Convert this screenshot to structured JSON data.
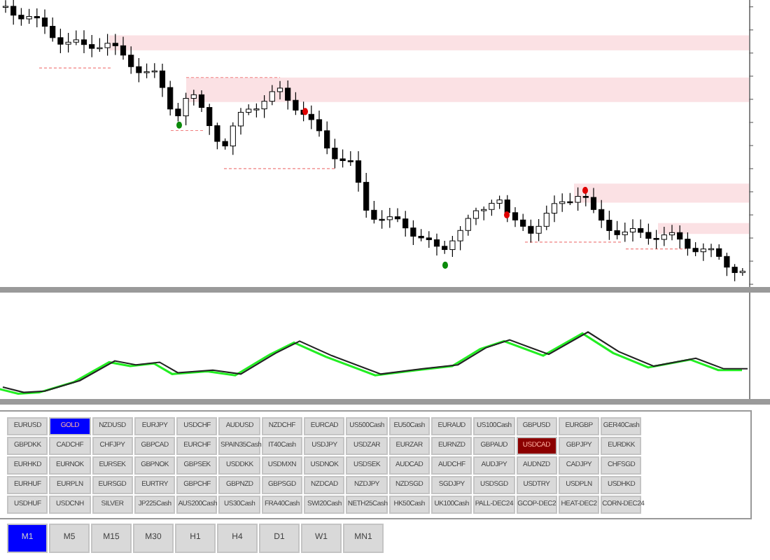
{
  "symbol_panel": {
    "rows": [
      [
        {
          "label": "EURUSD",
          "color": "#d9d9d9"
        },
        {
          "label": "GOLD",
          "color": "#0000ff"
        },
        {
          "label": "NZDUSD",
          "color": "#d9d9d9"
        },
        {
          "label": "EURJPY",
          "color": "#d9d9d9"
        },
        {
          "label": "USDCHF",
          "color": "#d9d9d9"
        },
        {
          "label": "AUDUSD",
          "color": "#d9d9d9"
        },
        {
          "label": "NZDCHF",
          "color": "#d9d9d9"
        },
        {
          "label": "EURCAD",
          "color": "#d9d9d9"
        },
        {
          "label": "US500Cash",
          "color": "#d9d9d9"
        },
        {
          "label": "EU50Cash",
          "color": "#d9d9d9"
        },
        {
          "label": "EURAUD",
          "color": "#d9d9d9"
        },
        {
          "label": "US100Cash",
          "color": "#d9d9d9"
        },
        {
          "label": "GBPUSD",
          "color": "#d9d9d9"
        },
        {
          "label": "EURGBP",
          "color": "#d9d9d9"
        },
        {
          "label": "GER40Cash",
          "color": "#d9d9d9"
        }
      ],
      [
        {
          "label": "GBPDKK",
          "color": "#d9d9d9"
        },
        {
          "label": "CADCHF",
          "color": "#d9d9d9"
        },
        {
          "label": "CHFJPY",
          "color": "#d9d9d9"
        },
        {
          "label": "GBPCAD",
          "color": "#d9d9d9"
        },
        {
          "label": "EURCHF",
          "color": "#d9d9d9"
        },
        {
          "label": "SPAIN35Cash",
          "color": "#d9d9d9"
        },
        {
          "label": "IT40Cash",
          "color": "#d9d9d9"
        },
        {
          "label": "USDJPY",
          "color": "#d9d9d9"
        },
        {
          "label": "USDZAR",
          "color": "#d9d9d9"
        },
        {
          "label": "EURZAR",
          "color": "#d9d9d9"
        },
        {
          "label": "EURNZD",
          "color": "#d9d9d9"
        },
        {
          "label": "GBPAUD",
          "color": "#d9d9d9"
        },
        {
          "label": "USDCAD",
          "color": "#8b0000"
        },
        {
          "label": "GBPJPY",
          "color": "#d9d9d9"
        },
        {
          "label": "EURDKK",
          "color": "#d9d9d9"
        }
      ],
      [
        {
          "label": "EURHKD",
          "color": "#d9d9d9"
        },
        {
          "label": "EURNOK",
          "color": "#d9d9d9"
        },
        {
          "label": "EURSEK",
          "color": "#d9d9d9"
        },
        {
          "label": "GBPNOK",
          "color": "#d9d9d9"
        },
        {
          "label": "GBPSEK",
          "color": "#d9d9d9"
        },
        {
          "label": "USDDKK",
          "color": "#d9d9d9"
        },
        {
          "label": "USDMXN",
          "color": "#d9d9d9"
        },
        {
          "label": "USDNOK",
          "color": "#d9d9d9"
        },
        {
          "label": "USDSEK",
          "color": "#d9d9d9"
        },
        {
          "label": "AUDCAD",
          "color": "#d9d9d9"
        },
        {
          "label": "AUDCHF",
          "color": "#d9d9d9"
        },
        {
          "label": "AUDJPY",
          "color": "#d9d9d9"
        },
        {
          "label": "AUDNZD",
          "color": "#d9d9d9"
        },
        {
          "label": "CADJPY",
          "color": "#d9d9d9"
        },
        {
          "label": "CHFSGD",
          "color": "#d9d9d9"
        }
      ],
      [
        {
          "label": "EURHUF",
          "color": "#d9d9d9"
        },
        {
          "label": "EURPLN",
          "color": "#d9d9d9"
        },
        {
          "label": "EURSGD",
          "color": "#d9d9d9"
        },
        {
          "label": "EURTRY",
          "color": "#d9d9d9"
        },
        {
          "label": "GBPCHF",
          "color": "#d9d9d9"
        },
        {
          "label": "GBPNZD",
          "color": "#d9d9d9"
        },
        {
          "label": "GBPSGD",
          "color": "#d9d9d9"
        },
        {
          "label": "NZDCAD",
          "color": "#d9d9d9"
        },
        {
          "label": "NZDJPY",
          "color": "#d9d9d9"
        },
        {
          "label": "NZDSGD",
          "color": "#d9d9d9"
        },
        {
          "label": "SGDJPY",
          "color": "#d9d9d9"
        },
        {
          "label": "USDSGD",
          "color": "#d9d9d9"
        },
        {
          "label": "USDTRY",
          "color": "#d9d9d9"
        },
        {
          "label": "USDPLN",
          "color": "#d9d9d9"
        },
        {
          "label": "USDHKD",
          "color": "#d9d9d9"
        }
      ],
      [
        {
          "label": "USDHUF",
          "color": "#d9d9d9"
        },
        {
          "label": "USDCNH",
          "color": "#d9d9d9"
        },
        {
          "label": "SILVER",
          "color": "#d9d9d9"
        },
        {
          "label": "JP225Cash",
          "color": "#d9d9d9"
        },
        {
          "label": "AUS200Cash",
          "color": "#d9d9d9"
        },
        {
          "label": "US30Cash",
          "color": "#d9d9d9"
        },
        {
          "label": "FRA40Cash",
          "color": "#d9d9d9"
        },
        {
          "label": "SWI20Cash",
          "color": "#d9d9d9"
        },
        {
          "label": "NETH25Cash",
          "color": "#d9d9d9"
        },
        {
          "label": "HK50Cash",
          "color": "#d9d9d9"
        },
        {
          "label": "UK100Cash",
          "color": "#d9d9d9"
        },
        {
          "label": "PALL-DEC24",
          "color": "#d9d9d9"
        },
        {
          "label": "GCOP-DEC2",
          "color": "#d9d9d9"
        },
        {
          "label": "HEAT-DEC2",
          "color": "#d9d9d9"
        },
        {
          "label": "CORN-DEC24",
          "color": "#d9d9d9"
        }
      ]
    ]
  },
  "timeframes": [
    {
      "label": "M1",
      "selected": true
    },
    {
      "label": "M5",
      "selected": false
    },
    {
      "label": "M15",
      "selected": false
    },
    {
      "label": "M30",
      "selected": false
    },
    {
      "label": "H1",
      "selected": false
    },
    {
      "label": "H4",
      "selected": false
    },
    {
      "label": "D1",
      "selected": false
    },
    {
      "label": "W1",
      "selected": false
    },
    {
      "label": "MN1",
      "selected": false
    }
  ]
}
